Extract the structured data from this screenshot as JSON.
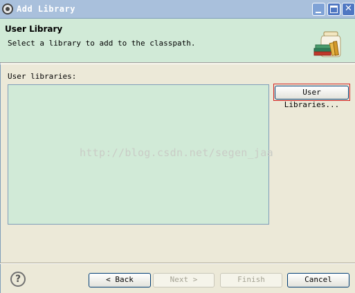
{
  "window": {
    "title": "Add Library",
    "icon": "eclipse-icon"
  },
  "header": {
    "title": "User Library",
    "description": "Select a library to add to the classpath."
  },
  "list": {
    "label": "User libraries:",
    "items": []
  },
  "buttons": {
    "user_libraries": "User Libraries...",
    "back": "< Back",
    "next": "Next >",
    "finish": "Finish",
    "cancel": "Cancel",
    "help": "?"
  },
  "watermark": "http://blog.csdn.net/segen_jaa",
  "colors": {
    "header_bg": "#d1ead7",
    "list_bg": "#d1ead7",
    "dialog_bg": "#ece9d8",
    "highlight_frame": "#d42020"
  }
}
